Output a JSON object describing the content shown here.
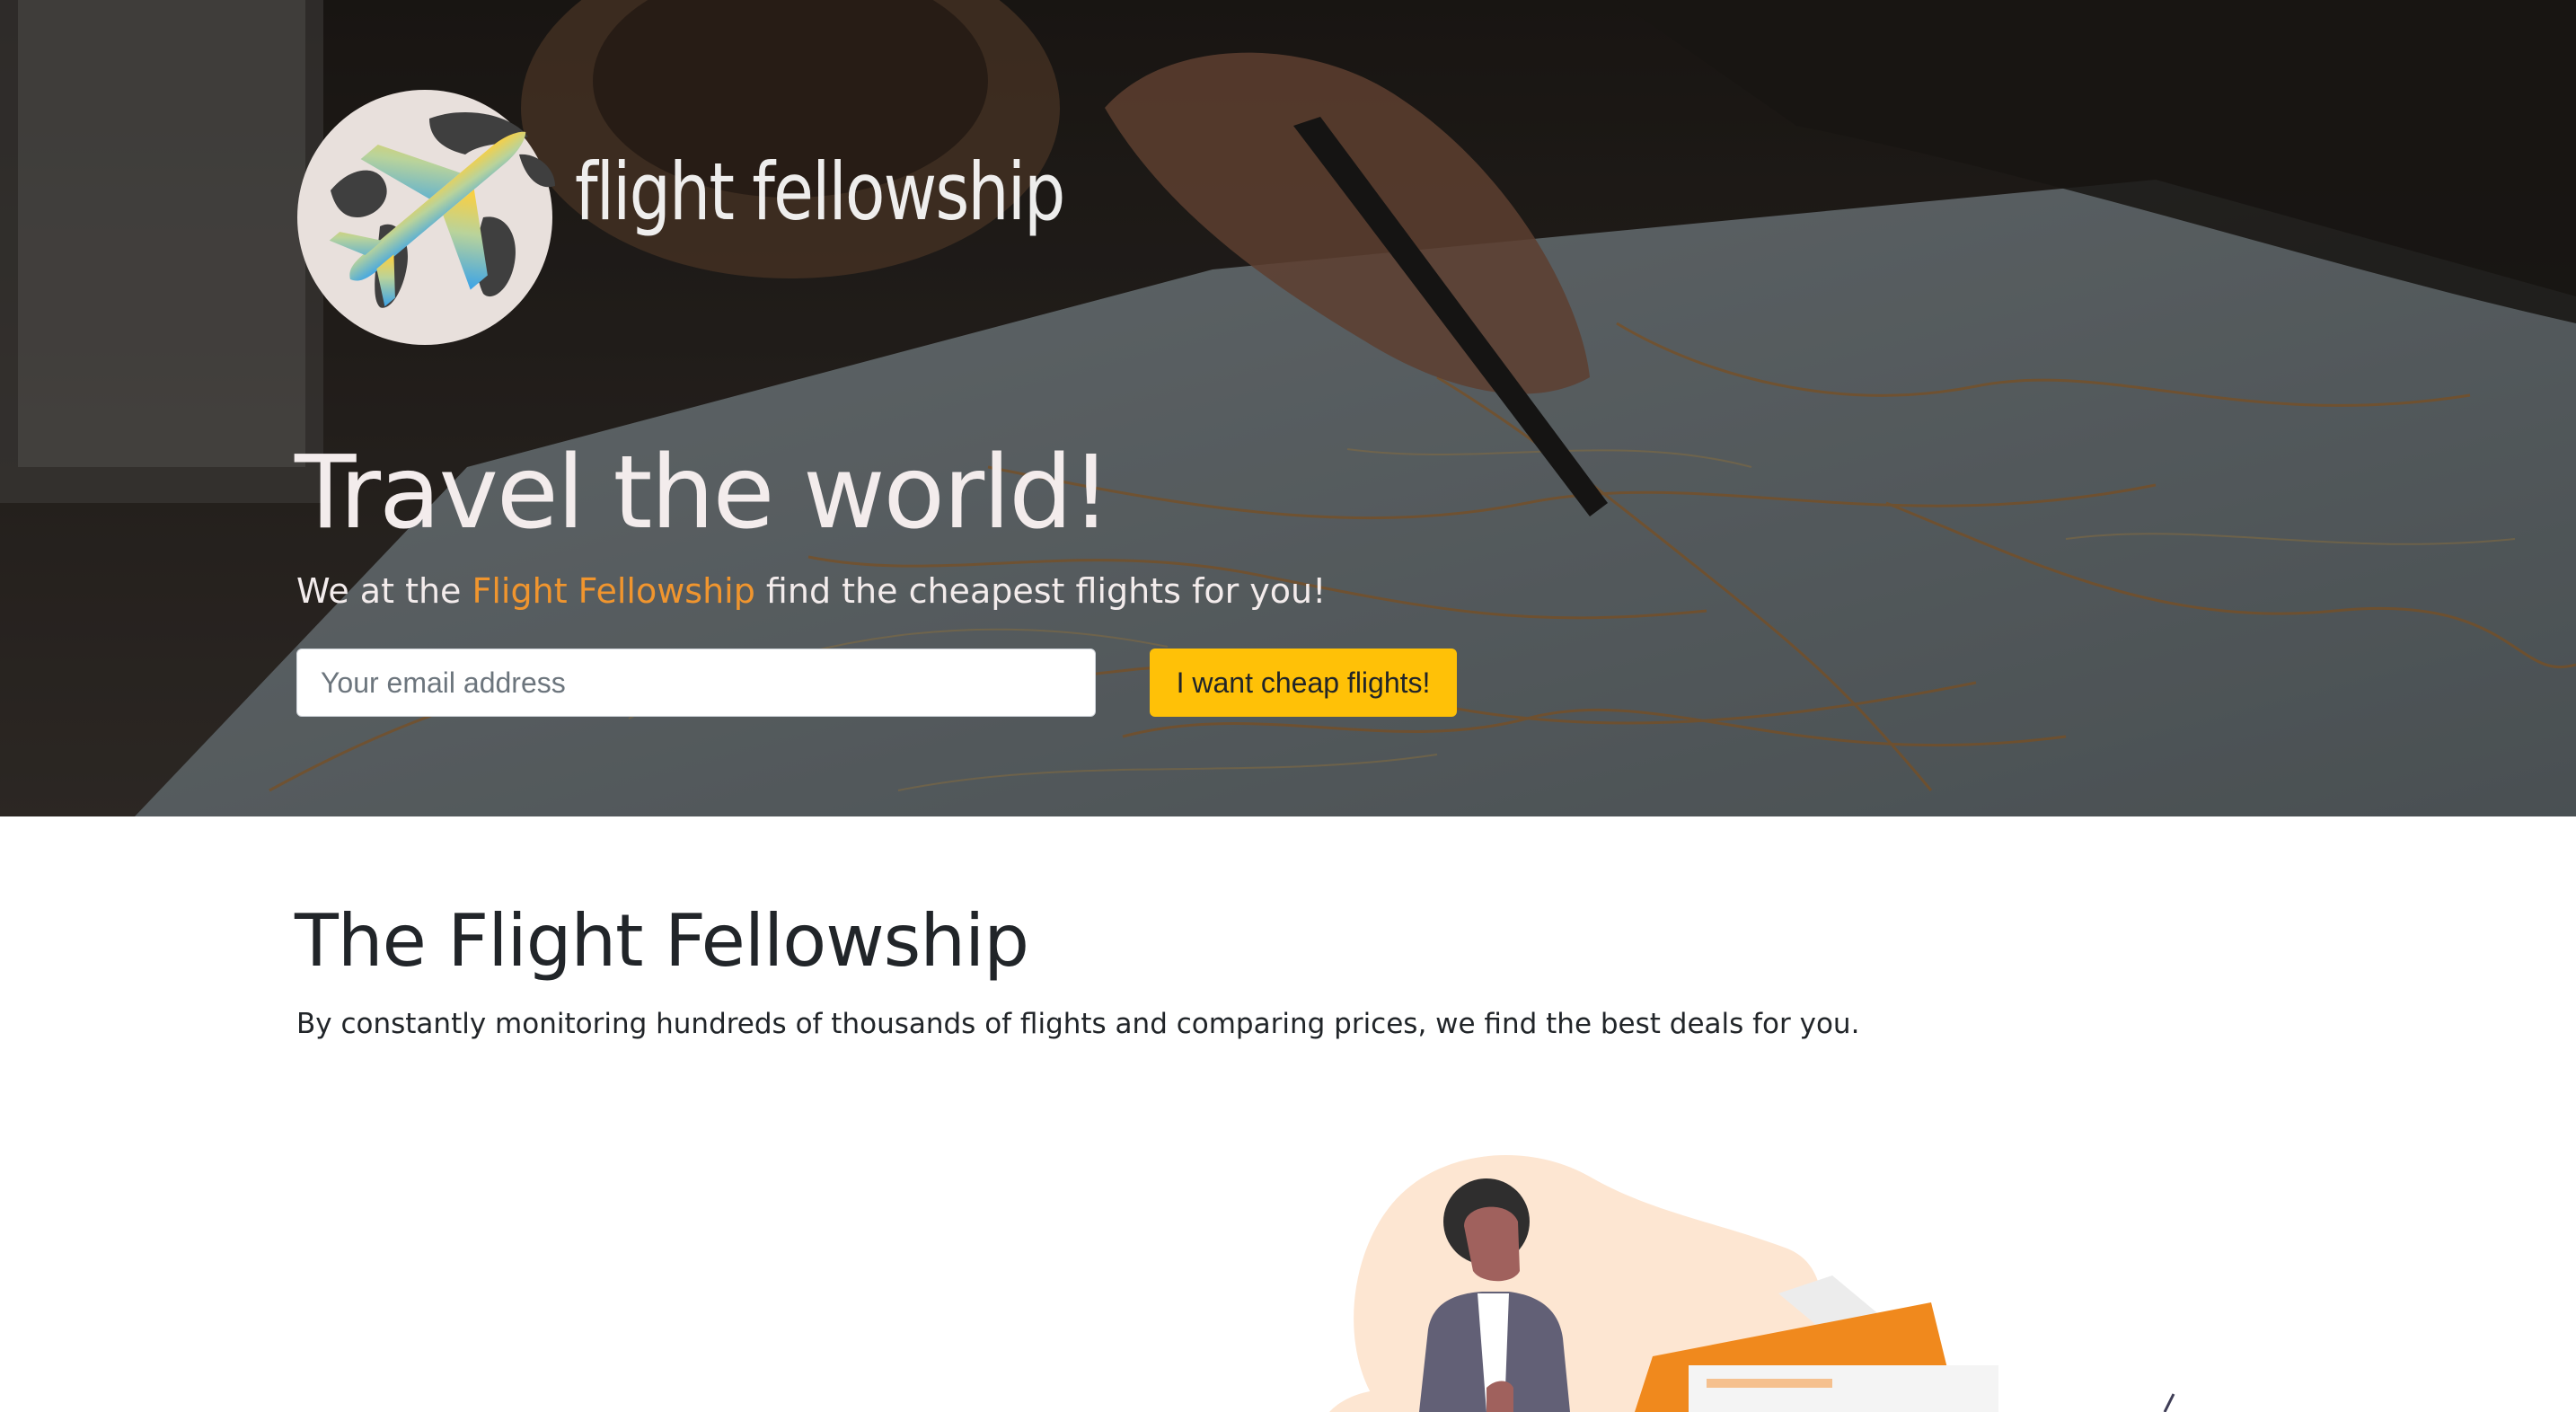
{
  "hero": {
    "brand_name": "flight fellowship",
    "title": "Travel the world!",
    "subtitle_prefix": "We at the ",
    "subtitle_highlight": "Flight Fellowship",
    "subtitle_suffix": " find the cheapest flights for you!",
    "email_placeholder": "Your email address",
    "email_value": "",
    "cta_label": "I want cheap flights!"
  },
  "about": {
    "title": "The Flight Fellowship",
    "text": "By constantly monitoring hundreds of thousands of flights and comparing prices, we find the best deals for you."
  },
  "colors": {
    "accent": "#f0952e",
    "button": "#ffc107",
    "heading_text": "#212529"
  },
  "icons": {
    "logo": "globe-airplane-logo",
    "illustration": "traveler-illustration"
  }
}
